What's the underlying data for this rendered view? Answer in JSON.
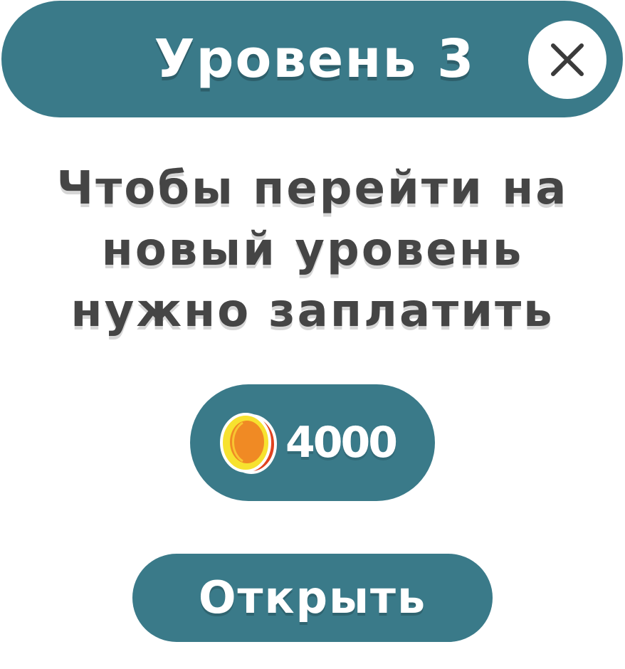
{
  "header": {
    "title": "Уровень 3",
    "close_icon": "close-icon"
  },
  "message": {
    "lines": [
      "Чтобы перейти на",
      "новый уровень",
      "нужно заплатить"
    ]
  },
  "price": {
    "icon": "coin-icon",
    "amount": "4000"
  },
  "action": {
    "open_label": "Открыть"
  },
  "colors": {
    "accent": "#3a7a89",
    "text_dark": "#454545",
    "coin_outer": "#f7e22f",
    "coin_inner": "#f08a24",
    "coin_shade": "#e0421f"
  }
}
